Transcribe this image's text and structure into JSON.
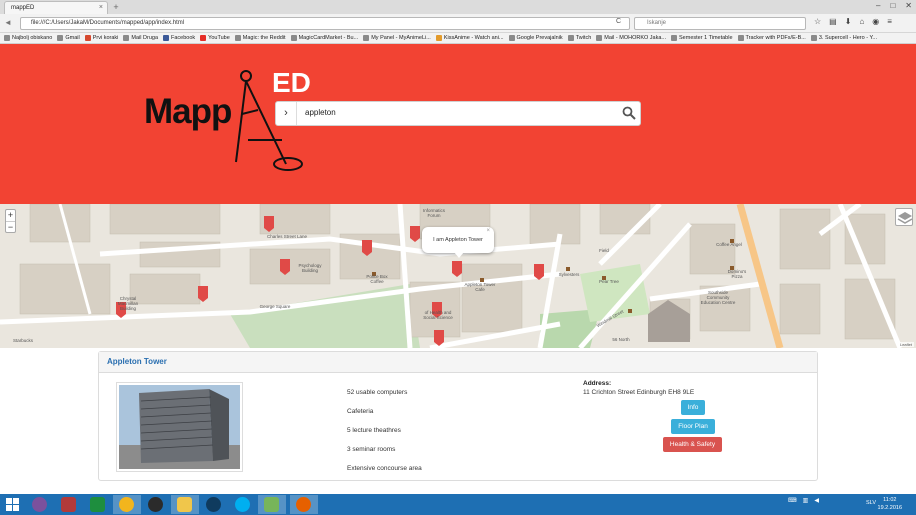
{
  "browser": {
    "tab_title": "mappED",
    "tab_close": "×",
    "new_tab": "+",
    "url": "file:///C:/Users/JakaM/Documents/mapped/app/index.html",
    "search_placeholder": "Iskanje",
    "back": "◄",
    "reload": "C",
    "window_controls": [
      "–",
      "□",
      "✕"
    ],
    "nav_icons": [
      "☆",
      "▤",
      "⬇",
      "⌂",
      "◉",
      "≡"
    ],
    "bookmarks": [
      "Najbolj obiskano",
      "Gmail",
      "Prvi koraki",
      "Mail Druga",
      "Facebook",
      "YouTube",
      "Magic: the Reddit",
      "MagicCardMarket - Bu...",
      "My Panel - MyAnimeLi...",
      "KissAnime - Watch ani...",
      "Google Prevajalnik",
      "Twitch",
      "Mail - MOHORKO Jaka...",
      "Semester 1 Timetable",
      "Tracker with PDFs/E-B...",
      "3. Supercell - Hero - Y..."
    ]
  },
  "header": {
    "logo_main": "Mapp",
    "logo_accent": "ED",
    "colors": {
      "header_bg": "#f24333",
      "logo_dark": "#111111",
      "logo_light": "#ffffff"
    },
    "search": {
      "toggle_icon": "›",
      "value": "appleton",
      "icon": "search-icon"
    }
  },
  "map": {
    "zoom_in": "+",
    "zoom_out": "−",
    "popup": {
      "text": "I am Appleton Tower",
      "close": "×"
    },
    "labels": {
      "informatics": "Informatics Forum",
      "charles_lane": "Charles Street Lane",
      "psychology": "Psychology Building",
      "police_box": "Police Box Coffee",
      "george_square": "George Square",
      "appleton_cafe": "Appleton Tower Cafe",
      "sylvesters": "Sylvesters",
      "pear_tree": "Pear Tree",
      "field": "Field",
      "coffee_angel": "Coffee Angel",
      "dominos": "Domino's Pizza",
      "southside": "Southside Community Education Centre",
      "windmill": "Windmill Street",
      "nicolson": "Nicolson Street",
      "starbucks": "Starbucks",
      "s6north": "56 North",
      "chrystal": "Chrystal Macmillan Building",
      "social_science": "of Health and Social Science",
      "attribution": "Leaflet"
    }
  },
  "building": {
    "name": "Appleton Tower",
    "facilities": [
      "52 usable computers",
      "Cafeteria",
      "5 lecture theathres",
      "3 seminar rooms",
      "Extensive concourse area"
    ],
    "address_label": "Address:",
    "address": "11 Crichton Street Edinburgh EH8 9LE",
    "buttons": {
      "info": "Info",
      "floor_plan": "Floor Plan",
      "health_safety": "Health & Safety"
    },
    "colors": {
      "link": "#2a6fb0",
      "info": "#3aafda",
      "danger": "#d9534f"
    }
  },
  "taskbar": {
    "lang": "SLV",
    "time": "11:02",
    "date": "19.2.2016",
    "apps": [
      "viber-icon",
      "game-icon",
      "spreadsheet-icon",
      "chrome-icon",
      "help-icon",
      "folder-icon",
      "steam-icon",
      "skype-icon",
      "image-icon",
      "firefox-icon"
    ]
  }
}
